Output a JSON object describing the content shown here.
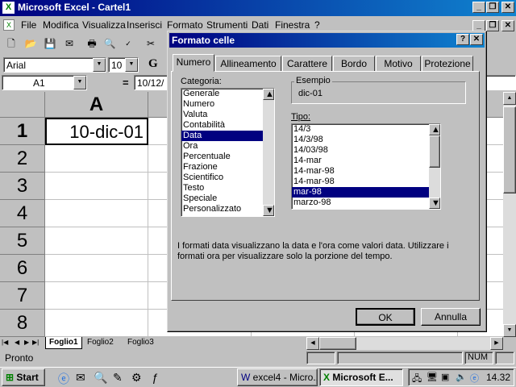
{
  "app": {
    "title": "Microsoft Excel - Cartel1"
  },
  "menu": [
    "File",
    "Modifica",
    "Visualizza",
    "Inserisci",
    "Formato",
    "Strumenti",
    "Dati",
    "Finestra",
    "?"
  ],
  "formula": {
    "font": "Arial",
    "size": "10",
    "bold": "G",
    "cell_ref": "A1",
    "equals": "=",
    "content": "10/12/"
  },
  "sheet": {
    "col_a": "A",
    "rows": [
      "1",
      "2",
      "3",
      "4",
      "5",
      "6",
      "7",
      "8"
    ],
    "a1_value": "10-dic-01",
    "tabs": [
      "Foglio1",
      "Foglio2",
      "Foglio3"
    ]
  },
  "status": {
    "left": "Pronto",
    "num": "NUM"
  },
  "dialog": {
    "title": "Formato celle",
    "help": "?",
    "close": "✕",
    "tabs": [
      "Numero",
      "Allineamento",
      "Carattere",
      "Bordo",
      "Motivo",
      "Protezione"
    ],
    "categoria_label": "Categoria:",
    "categories": [
      "Generale",
      "Numero",
      "Valuta",
      "Contabilità",
      "Data",
      "Ora",
      "Percentuale",
      "Frazione",
      "Scientifico",
      "Testo",
      "Speciale",
      "Personalizzato"
    ],
    "selected_category": "Data",
    "esempio_label": "Esempio",
    "esempio_value": "dic-01",
    "tipo_label": "Tipo:",
    "types": [
      "14/3",
      "14/3/98",
      "14/03/98",
      "14-mar",
      "14-mar-98",
      "14-mar-98",
      "mar-98",
      "marzo-98"
    ],
    "selected_type": "mar-98",
    "description": "I formati data visualizzano la data e l'ora come valori data. Utilizzare i formati ora per visualizzare solo la porzione del tempo.",
    "ok": "OK",
    "cancel": "Annulla"
  },
  "taskbar": {
    "start": "Start",
    "tasks": [
      "excel4 - Micro...",
      "Microsoft E..."
    ],
    "clock": "14.32"
  },
  "colors": {
    "title": "#000080",
    "selection": "#000080",
    "desktop": "#c0c0c0"
  }
}
